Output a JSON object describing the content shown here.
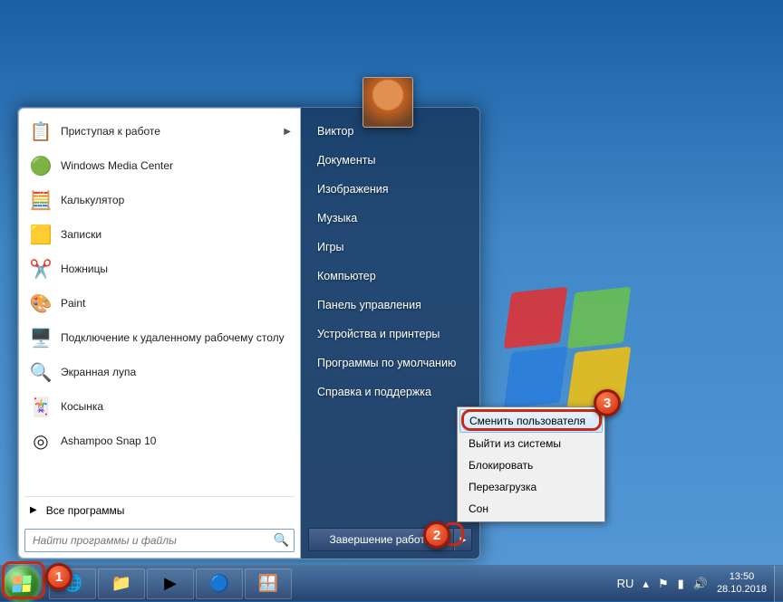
{
  "wallpaper": {
    "name": "Windows 7 default sky"
  },
  "start_menu": {
    "programs": [
      {
        "label": "Приступая к работе",
        "icon": "getting-started-icon",
        "glyph": "📋",
        "has_submenu": true
      },
      {
        "label": "Windows Media Center",
        "icon": "media-center-icon",
        "glyph": "🟢"
      },
      {
        "label": "Калькулятор",
        "icon": "calculator-icon",
        "glyph": "🧮"
      },
      {
        "label": "Записки",
        "icon": "sticky-notes-icon",
        "glyph": "🟨"
      },
      {
        "label": "Ножницы",
        "icon": "snipping-tool-icon",
        "glyph": "✂️"
      },
      {
        "label": "Paint",
        "icon": "paint-icon",
        "glyph": "🎨"
      },
      {
        "label": "Подключение к удаленному рабочему столу",
        "icon": "remote-desktop-icon",
        "glyph": "🖥️"
      },
      {
        "label": "Экранная лупа",
        "icon": "magnifier-icon",
        "glyph": "🔍"
      },
      {
        "label": "Косынка",
        "icon": "solitaire-icon",
        "glyph": "🃏"
      },
      {
        "label": "Ashampoo Snap 10",
        "icon": "snap-icon",
        "glyph": "◎"
      }
    ],
    "all_programs_label": "Все программы",
    "search_placeholder": "Найти программы и файлы",
    "right_items": [
      "Виктор",
      "Документы",
      "Изображения",
      "Музыка",
      "Игры",
      "Компьютер",
      "Панель управления",
      "Устройства и принтеры",
      "Программы по умолчанию",
      "Справка и поддержка"
    ],
    "shutdown_label": "Завершение работы"
  },
  "shutdown_submenu": [
    "Сменить пользователя",
    "Выйти из системы",
    "Блокировать",
    "Перезагрузка",
    "Сон"
  ],
  "taskbar": {
    "pinned": [
      {
        "name": "internet-explorer-icon",
        "glyph": "🌐"
      },
      {
        "name": "file-explorer-icon",
        "glyph": "📁"
      },
      {
        "name": "media-player-icon",
        "glyph": "▶"
      },
      {
        "name": "chrome-icon",
        "glyph": "🔵"
      },
      {
        "name": "window-switcher-icon",
        "glyph": "🪟"
      }
    ],
    "lang": "RU",
    "time": "13:50",
    "date": "28.10.2018"
  },
  "callouts": {
    "c1": "1",
    "c2": "2",
    "c3": "3"
  }
}
